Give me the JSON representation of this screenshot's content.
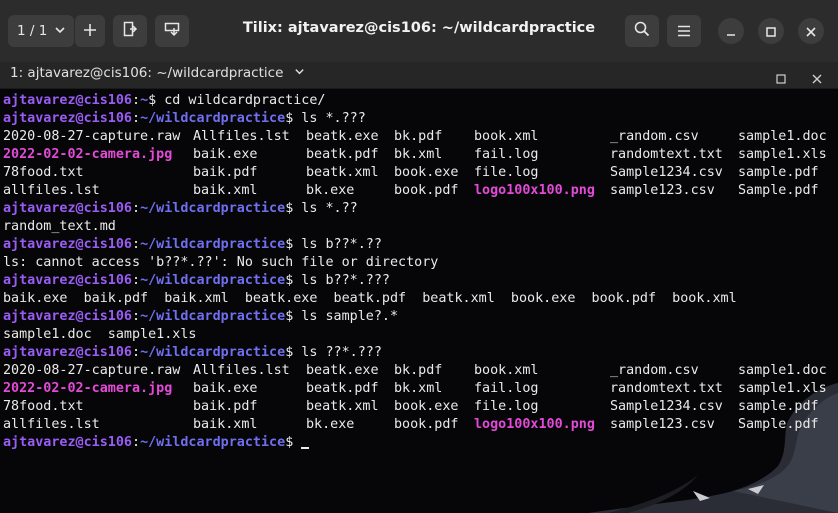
{
  "header": {
    "tab_counter": "1 / 1",
    "title": "Tilix: ajtavarez@cis106: ~/wildcardpractice"
  },
  "tab": {
    "label": "1: ajtavarez@cis106: ~/wildcardpractice"
  },
  "colors": {
    "user": "#9a5cf5",
    "path": "#6f6ff0",
    "highlight": "#e34ad8",
    "text": "#eaeaea"
  },
  "terminal": {
    "lines": [
      {
        "type": "prompt",
        "user": "ajtavarez@cis106",
        "sep": ":",
        "path": "~",
        "dollar": "$",
        "cmd": " cd wildcardpractice/"
      },
      {
        "type": "prompt",
        "user": "ajtavarez@cis106",
        "sep": ":",
        "path": "~/wildcardpractice",
        "dollar": "$",
        "cmd": " ls *.???"
      },
      {
        "type": "row",
        "cells": [
          "2020-08-27-capture.raw",
          "Allfiles.lst",
          "beatk.exe",
          "bk.pdf",
          "book.xml",
          "_random.csv",
          "sample1.doc"
        ]
      },
      {
        "type": "row",
        "cells": [
          "2022-02-02-camera.jpg",
          "baik.exe",
          "beatk.pdf",
          "bk.xml",
          "fail.log",
          "randomtext.txt",
          "sample1.xls"
        ],
        "hl": [
          0
        ]
      },
      {
        "type": "row",
        "cells": [
          "78food.txt",
          "baik.pdf",
          "beatk.xml",
          "book.exe",
          "file.log",
          "Sample1234.csv",
          "sample.pdf"
        ]
      },
      {
        "type": "row",
        "cells": [
          "allfiles.lst",
          "baik.xml",
          "bk.exe",
          "book.pdf",
          "logo100x100.png",
          "sample123.csv",
          "Sample.pdf"
        ],
        "hl": [
          4
        ]
      },
      {
        "type": "prompt",
        "user": "ajtavarez@cis106",
        "sep": ":",
        "path": "~/wildcardpractice",
        "dollar": "$",
        "cmd": " ls *.??"
      },
      {
        "type": "text",
        "text": "random_text.md"
      },
      {
        "type": "prompt",
        "user": "ajtavarez@cis106",
        "sep": ":",
        "path": "~/wildcardpractice",
        "dollar": "$",
        "cmd": " ls b??*.??"
      },
      {
        "type": "text",
        "text": "ls: cannot access 'b??*.??': No such file or directory"
      },
      {
        "type": "prompt",
        "user": "ajtavarez@cis106",
        "sep": ":",
        "path": "~/wildcardpractice",
        "dollar": "$",
        "cmd": " ls b??*.???"
      },
      {
        "type": "text",
        "text": "baik.exe  baik.pdf  baik.xml  beatk.exe  beatk.pdf  beatk.xml  book.exe  book.pdf  book.xml"
      },
      {
        "type": "prompt",
        "user": "ajtavarez@cis106",
        "sep": ":",
        "path": "~/wildcardpractice",
        "dollar": "$",
        "cmd": " ls sample?.*"
      },
      {
        "type": "text",
        "text": "sample1.doc  sample1.xls"
      },
      {
        "type": "prompt",
        "user": "ajtavarez@cis106",
        "sep": ":",
        "path": "~/wildcardpractice",
        "dollar": "$",
        "cmd": " ls ??*.???"
      },
      {
        "type": "row",
        "cells": [
          "2020-08-27-capture.raw",
          "Allfiles.lst",
          "beatk.exe",
          "bk.pdf",
          "book.xml",
          "_random.csv",
          "sample1.doc"
        ]
      },
      {
        "type": "row",
        "cells": [
          "2022-02-02-camera.jpg",
          "baik.exe",
          "beatk.pdf",
          "bk.xml",
          "fail.log",
          "randomtext.txt",
          "sample1.xls"
        ],
        "hl": [
          0
        ]
      },
      {
        "type": "row",
        "cells": [
          "78food.txt",
          "baik.pdf",
          "beatk.xml",
          "book.exe",
          "file.log",
          "Sample1234.csv",
          "sample.pdf"
        ]
      },
      {
        "type": "row",
        "cells": [
          "allfiles.lst",
          "baik.xml",
          "bk.exe",
          "book.pdf",
          "logo100x100.png",
          "sample123.csv",
          "Sample.pdf"
        ],
        "hl": [
          4
        ]
      },
      {
        "type": "prompt",
        "user": "ajtavarez@cis106",
        "sep": ":",
        "path": "~/wildcardpractice",
        "dollar": "$",
        "cmd": " ",
        "cursor": true
      }
    ]
  }
}
